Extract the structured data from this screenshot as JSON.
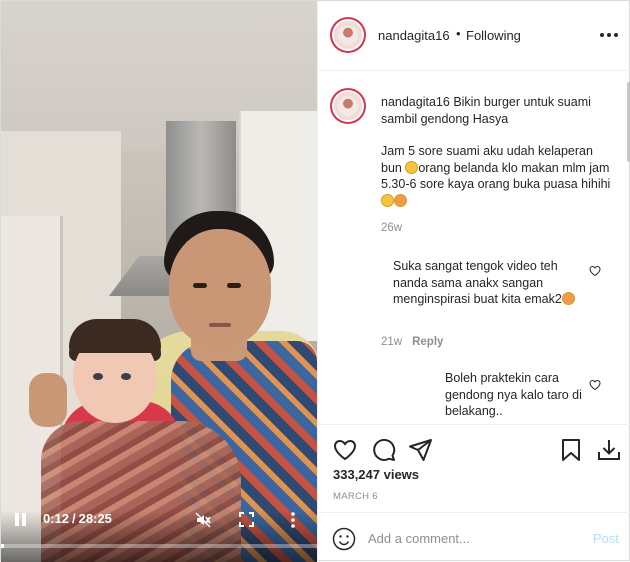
{
  "video": {
    "current_time": "0:12",
    "duration": "28:25",
    "progress": 0.007,
    "icons": {
      "play_state": "pause-icon",
      "audio": "muted-icon",
      "fullscreen": "fullscreen-icon",
      "menu": "more-vertical-icon"
    }
  },
  "header": {
    "username": "nandagita16",
    "separator": "•",
    "follow_status": "Following",
    "more_icon": "more-horizontal-icon"
  },
  "caption": {
    "username": "nandagita16",
    "line1": "Bikin burger untuk suami sambil gendong Hasya",
    "line2_a": "Jam 5 sore suami aku udah kelaperan bun",
    "line2_b": "orang belanda klo makan mlm jam 5.30-6 sore kaya orang buka puasa hihihi",
    "time": "26w"
  },
  "comments": [
    {
      "text": "Suka sangat tengok video teh nanda sama anakx sangan menginspirasi buat kita emak2",
      "time": "21w",
      "reply_label": "Reply"
    },
    {
      "text": "Boleh praktekin cara gendong nya kalo taro di belakang..",
      "time": "",
      "reply_label": ""
    }
  ],
  "actions": {
    "views": "333,247 views",
    "date": "MARCH 6"
  },
  "add_comment": {
    "placeholder": "Add a comment...",
    "post_label": "Post"
  },
  "colors": {
    "text": "#262626",
    "muted": "#8e8e8e",
    "post_disabled": "#b2dffc",
    "avatar_ring": "#d8344f"
  }
}
